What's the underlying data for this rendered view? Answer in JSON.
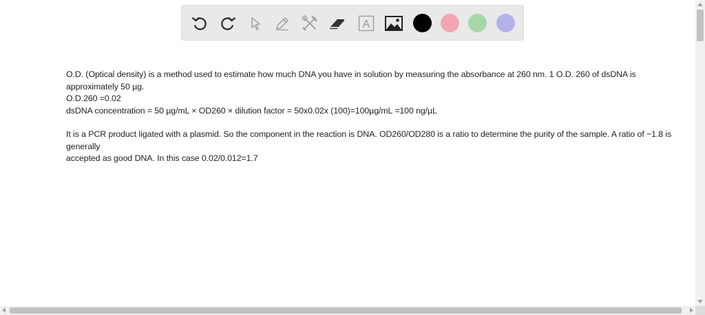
{
  "toolbar": {
    "tools": [
      {
        "name": "undo-icon",
        "enabled": true
      },
      {
        "name": "redo-icon",
        "enabled": true
      },
      {
        "name": "select-pointer-icon",
        "enabled": false
      },
      {
        "name": "pen-icon",
        "enabled": false
      },
      {
        "name": "tools-icon",
        "enabled": false
      },
      {
        "name": "eraser-icon",
        "enabled": true
      },
      {
        "name": "text-box-icon",
        "enabled": false
      },
      {
        "name": "image-icon",
        "enabled": true
      }
    ],
    "text_tool_glyph": "A",
    "colors": {
      "black": "#000000",
      "red": "#f2a7b0",
      "green": "#a7d7a9",
      "blue": "#b3b3ea"
    },
    "enabled_icon_color": "#333333",
    "disabled_icon_color": "#9a9a9a"
  },
  "content": {
    "paragraph1_line1": "O.D. (Optical density) is a method used to estimate how much DNA you have in solution by measuring the absorbance at 260 nm. 1 O.D. 260 of dsDNA is approximately 50 µg.",
    "paragraph1_line2": "O.D.260 =0.02",
    "paragraph1_line3": "dsDNA concentration = 50 µg/mL × OD260 × dilution factor = 50x0.02x (100)=100µg/mL =100 ng/µL",
    "paragraph2_line1": "It is a PCR product ligated with a plasmid. So the component in the reaction is DNA. OD260/OD280 is a ratio to determine the purity of the sample. A ratio of ~1.8 is generally",
    "paragraph2_line2": "accepted as good DNA. In this case 0.02/0.012=1.7"
  }
}
